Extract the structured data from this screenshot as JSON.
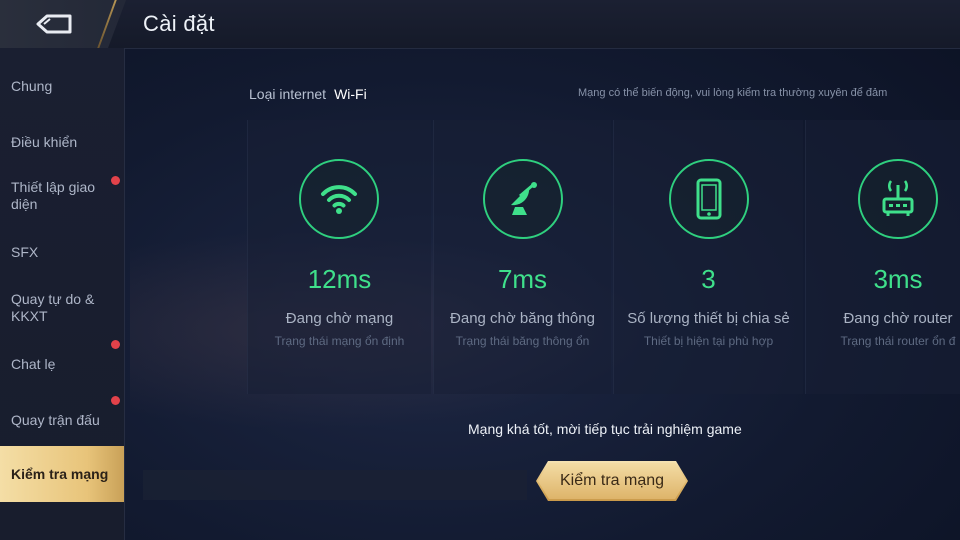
{
  "header": {
    "title": "Cài đặt",
    "back_icon": "back-arrow-icon"
  },
  "sidebar": {
    "items": [
      {
        "label": "Chung",
        "badge": false,
        "active": false
      },
      {
        "label": "Điều khiển",
        "badge": false,
        "active": false
      },
      {
        "label": "Thiết lập giao diện",
        "badge": true,
        "active": false
      },
      {
        "label": "SFX",
        "badge": false,
        "active": false
      },
      {
        "label": "Quay tự do & KKXT",
        "badge": false,
        "active": false
      },
      {
        "label": "Chat lẹ",
        "badge": true,
        "active": false
      },
      {
        "label": "Quay trận đấu",
        "badge": true,
        "active": false
      },
      {
        "label": "Kiểm tra mạng",
        "badge": false,
        "active": true
      }
    ]
  },
  "network": {
    "internet_label": "Loại internet",
    "internet_value": "Wi-Fi",
    "notice": "Mạng có thể biến động, vui lòng kiểm tra thường xuyên để đảm"
  },
  "cards": [
    {
      "icon": "wifi-icon",
      "value": "12ms",
      "label": "Đang chờ mạng",
      "status": "Trạng thái mạng ổn định"
    },
    {
      "icon": "satellite-dish-icon",
      "value": "7ms",
      "label": "Đang chờ băng thông",
      "status": "Trạng thái băng thông ổn"
    },
    {
      "icon": "phone-icon",
      "value": "3",
      "label": "Số lượng thiết bị chia sẻ",
      "status": "Thiết bị hiện tại phù hợp"
    },
    {
      "icon": "router-icon",
      "value": "3ms",
      "label": "Đang chờ router",
      "status": "Trạng thái router ổn đ"
    }
  ],
  "result": {
    "message": "Mạng khá tốt, mời tiếp tục trải nghiệm game"
  },
  "actions": {
    "check_button": "Kiểm tra mạng"
  },
  "colors": {
    "accent_green": "#3fe08b",
    "active_gold": "#e8c47a",
    "badge_red": "#e2424a"
  }
}
